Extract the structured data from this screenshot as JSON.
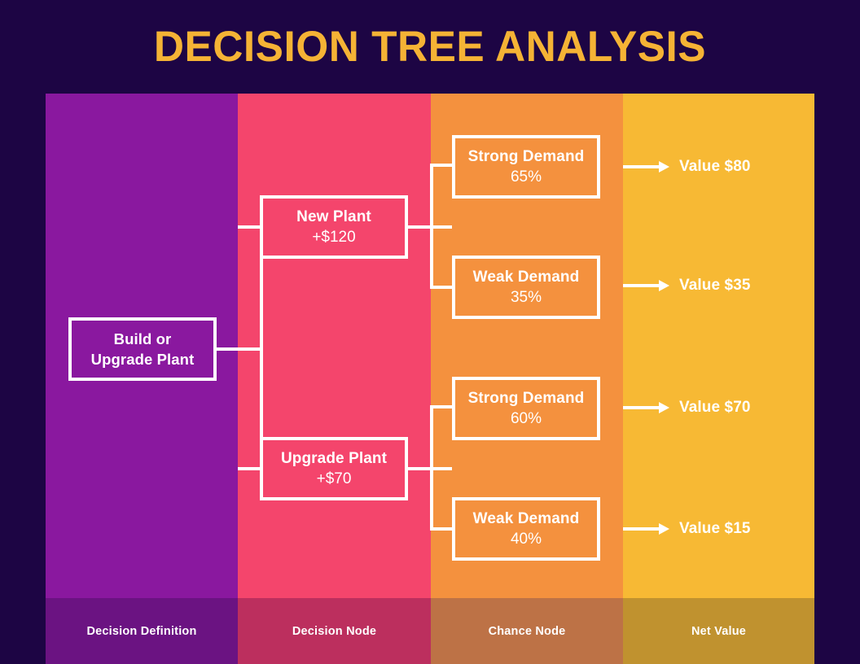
{
  "title": "DECISION TREE ANALYSIS",
  "colors": {
    "background": "#1d0544",
    "title": "#f5b335",
    "column_decision_definition": "#8a189f",
    "column_decision_node": "#f4456c",
    "column_chance_node": "#f4913e",
    "column_net_value": "#f7b934",
    "footer_decision_definition": "#6b1382",
    "footer_decision_node": "#bc2f5e",
    "footer_chance_node": "#bd7246",
    "footer_net_value": "#c0922f",
    "node_border": "#ffffff",
    "node_text": "#ffffff"
  },
  "columns": [
    {
      "label": "Decision Definition"
    },
    {
      "label": "Decision Node"
    },
    {
      "label": "Chance Node"
    },
    {
      "label": "Net Value"
    }
  ],
  "tree": {
    "root": {
      "line1": "Build or",
      "line2": "Upgrade Plant"
    },
    "decisions": [
      {
        "name": "New Plant",
        "value": "+$120"
      },
      {
        "name": "Upgrade Plant",
        "value": "+$70"
      }
    ],
    "chances": [
      {
        "name": "Strong Demand",
        "probability": "65%"
      },
      {
        "name": "Weak Demand",
        "probability": "35%"
      },
      {
        "name": "Strong Demand",
        "probability": "60%"
      },
      {
        "name": "Weak Demand",
        "probability": "40%"
      }
    ],
    "values": [
      {
        "label": "Value $80"
      },
      {
        "label": "Value $35"
      },
      {
        "label": "Value $70"
      },
      {
        "label": "Value $15"
      }
    ]
  },
  "chart_data": {
    "type": "diagram",
    "title": "DECISION TREE ANALYSIS",
    "stages": [
      "Decision Definition",
      "Decision Node",
      "Chance Node",
      "Net Value"
    ],
    "nodes": [
      {
        "id": "root",
        "stage": "Decision Definition",
        "label": "Build or Upgrade Plant"
      },
      {
        "id": "new_plant",
        "stage": "Decision Node",
        "label": "New Plant",
        "cost": 120,
        "cost_label": "+$120"
      },
      {
        "id": "upgrade_plant",
        "stage": "Decision Node",
        "label": "Upgrade Plant",
        "cost": 70,
        "cost_label": "+$70"
      },
      {
        "id": "new_strong",
        "stage": "Chance Node",
        "label": "Strong Demand",
        "probability": 0.65,
        "probability_label": "65%"
      },
      {
        "id": "new_weak",
        "stage": "Chance Node",
        "label": "Weak Demand",
        "probability": 0.35,
        "probability_label": "35%"
      },
      {
        "id": "upg_strong",
        "stage": "Chance Node",
        "label": "Strong Demand",
        "probability": 0.6,
        "probability_label": "60%"
      },
      {
        "id": "upg_weak",
        "stage": "Chance Node",
        "label": "Weak Demand",
        "probability": 0.4,
        "probability_label": "40%"
      },
      {
        "id": "val_80",
        "stage": "Net Value",
        "label": "Value $80",
        "value": 80
      },
      {
        "id": "val_35",
        "stage": "Net Value",
        "label": "Value $35",
        "value": 35
      },
      {
        "id": "val_70",
        "stage": "Net Value",
        "label": "Value $70",
        "value": 70
      },
      {
        "id": "val_15",
        "stage": "Net Value",
        "label": "Value $15",
        "value": 15
      }
    ],
    "edges": [
      {
        "from": "root",
        "to": "new_plant"
      },
      {
        "from": "root",
        "to": "upgrade_plant"
      },
      {
        "from": "new_plant",
        "to": "new_strong"
      },
      {
        "from": "new_plant",
        "to": "new_weak"
      },
      {
        "from": "upgrade_plant",
        "to": "upg_strong"
      },
      {
        "from": "upgrade_plant",
        "to": "upg_weak"
      },
      {
        "from": "new_strong",
        "to": "val_80"
      },
      {
        "from": "new_weak",
        "to": "val_35"
      },
      {
        "from": "upg_strong",
        "to": "val_70"
      },
      {
        "from": "upg_weak",
        "to": "val_15"
      }
    ]
  }
}
